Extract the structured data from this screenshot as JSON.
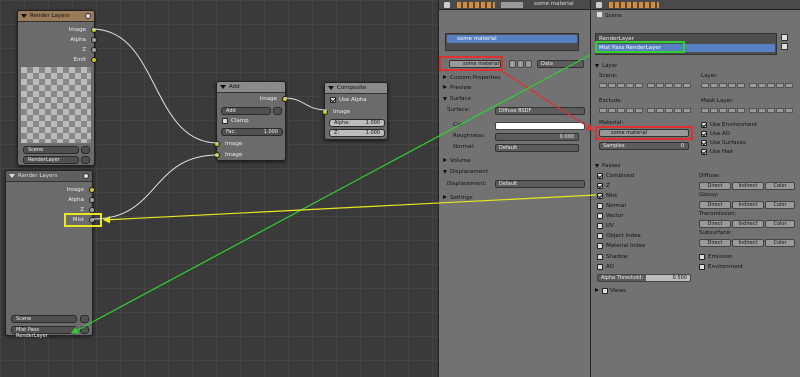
{
  "nodes": {
    "render_layers_1": {
      "title": "Render Layers",
      "outputs": [
        "Image",
        "Alpha",
        "Z",
        "Emit"
      ],
      "scene": "Scene",
      "layer": "RenderLayer"
    },
    "render_layers_2": {
      "title": "Render Layers",
      "outputs": [
        "Image",
        "Alpha",
        "Z",
        "Mist"
      ],
      "scene": "Scene",
      "layer": "Mist Pass RenderLayer"
    },
    "add": {
      "title": "Add",
      "output": "Image",
      "blend": "Add",
      "clamp": "Clamp",
      "fac_label": "Fac:",
      "fac_value": "1.000",
      "inputs": [
        "Image",
        "Image"
      ]
    },
    "composite": {
      "title": "Composite",
      "use_alpha": "Use Alpha",
      "image": "Image",
      "alpha_label": "Alpha:",
      "alpha_value": "1.000",
      "z_label": "Z:",
      "z_value": "1.000"
    }
  },
  "material_panel": {
    "material_name": "some material",
    "slot": "some material",
    "data": "Data",
    "sections": {
      "custom": "Custom Properties",
      "preview": "Preview",
      "surface": "Surface",
      "volume": "Volume",
      "displacement": "Displacement",
      "settings": "Settings"
    },
    "surface_label": "Surface:",
    "surface_value": "Diffuse BSDF",
    "color_label": "Col",
    "roughness_label": "Roughness:",
    "roughness_value": "0.000",
    "normal_label": "Normal:",
    "normal_value": "Default",
    "displacement_label": "Displacement:",
    "displacement_value": "Default"
  },
  "scene_panel": {
    "breadcrumb": "Scene",
    "layers": [
      "RenderLayer",
      "Mist Pass RenderLayer"
    ],
    "layer_section": "Layer",
    "scene_label": "Scene:",
    "layer_label": "Layer:",
    "exclude_label": "Exclude:",
    "mask_layer_label": "Mask Layer:",
    "material_label": "Material:",
    "material_value": "some material",
    "samples_label": "Samples:",
    "samples_value": "0",
    "use_options": [
      "Use Environment",
      "Use AO",
      "Use Surfaces",
      "Use Hair"
    ],
    "passes_section": "Passes",
    "passes_left": [
      "Combined",
      "Z",
      "Mist",
      "Normal",
      "Vector",
      "UV",
      "Object Index",
      "Material Index",
      "Shadow",
      "AO"
    ],
    "passes_right_heads": [
      "Diffuse:",
      "Glossy:",
      "Transmission:",
      "Subsurface:"
    ],
    "direct": "Direct",
    "indirect": "Indirect",
    "color": "Color",
    "emission": "Emission",
    "environment": "Environment",
    "alpha_threshold_label": "Alpha Threshold:",
    "alpha_threshold_value": "0.500",
    "views": "Views"
  }
}
